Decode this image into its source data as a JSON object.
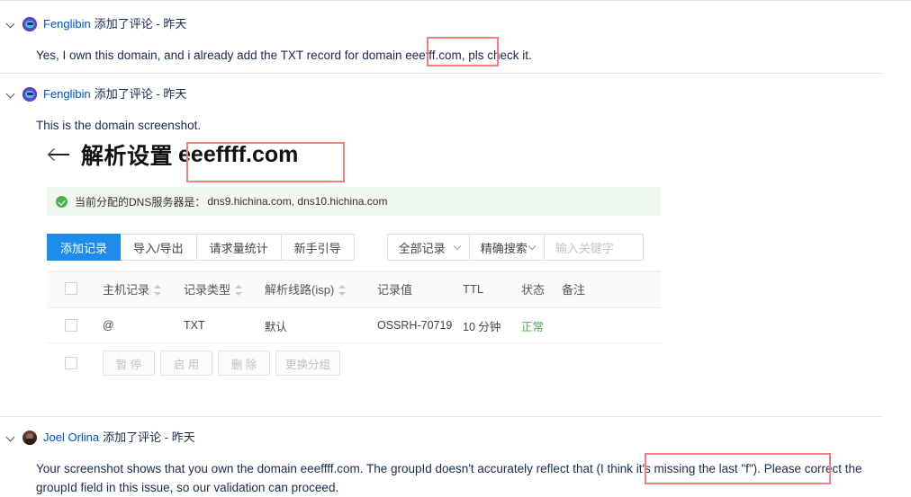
{
  "comments": [
    {
      "id": "comment-1",
      "author": "Fenglibin",
      "avatar_type": "bot-avatar",
      "action": "添加了评论 - 昨天",
      "body_before": "Yes, I own this domain, and i already add the TXT record for domain ",
      "body_highlight": "eeefff.com,",
      "body_after": " pls check it."
    },
    {
      "id": "comment-2",
      "author": "Fenglibin",
      "avatar_type": "bot-avatar",
      "action": "添加了评论 - 昨天",
      "body": "This is the domain screenshot."
    },
    {
      "id": "comment-3",
      "author": "Joel Orlina",
      "avatar_type": "photo-avatar",
      "action": "添加了评论 - 昨天",
      "body_before": "Your screenshot shows that you own the domain eeeffff.com. The groupId doesn't accurately reflect that ",
      "body_highlight": "(I think it's missing the last \"f\").",
      "body_after": " Please correct the groupId field in this issue, so our validation can proceed."
    }
  ],
  "embedded_screenshot": {
    "header": {
      "back_label": "back-arrow",
      "title_cn": "解析设置",
      "domain": "eeeffff.com"
    },
    "banner": {
      "label": "当前分配的DNS服务器是：",
      "servers": "dns9.hichina.com, dns10.hichina.com"
    },
    "toolbar": {
      "buttons": [
        {
          "label": "添加记录",
          "primary": true
        },
        {
          "label": "导入/导出",
          "primary": false
        },
        {
          "label": "请求量统计",
          "primary": false
        },
        {
          "label": "新手引导",
          "primary": false
        }
      ],
      "record_filter": "全部记录",
      "search_mode": "精确搜索",
      "search_placeholder": "输入关键字"
    },
    "table": {
      "columns": [
        {
          "label": "主机记录",
          "sortable": true
        },
        {
          "label": "记录类型",
          "sortable": true
        },
        {
          "label": "解析线路(isp)",
          "sortable": true
        },
        {
          "label": "记录值",
          "sortable": false
        },
        {
          "label": "TTL",
          "sortable": false
        },
        {
          "label": "状态",
          "sortable": false
        },
        {
          "label": "备注",
          "sortable": false
        }
      ],
      "rows": [
        {
          "host": "@",
          "type": "TXT",
          "line": "默认",
          "value": "OSSRH-70719",
          "ttl": "10 分钟",
          "status": "正常",
          "note": ""
        }
      ],
      "bulk_actions": [
        "暂 停",
        "启 用",
        "删 除",
        "更换分组"
      ]
    }
  },
  "colors": {
    "link": "#0052cc",
    "annotation_box": "#f08080",
    "primary_button": "#1f8ceb",
    "status_ok": "#4caf50",
    "banner_bg": "#f0f9f0"
  }
}
